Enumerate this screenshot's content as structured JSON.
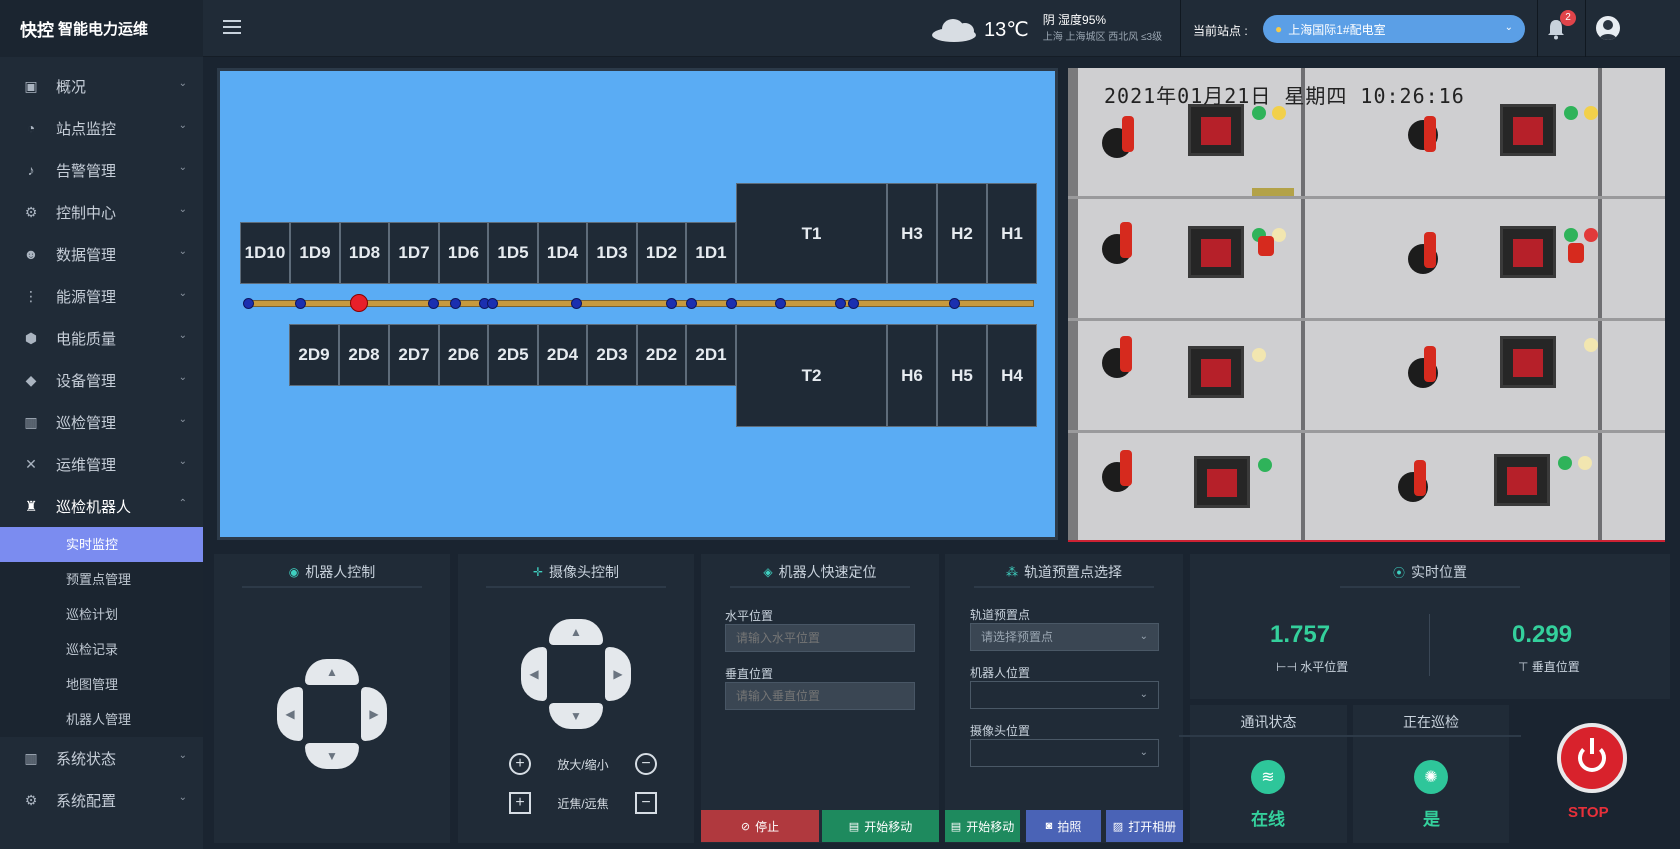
{
  "brand": {
    "title": "快控",
    "subtitle": "智能电力运维"
  },
  "sidebar": {
    "items": [
      {
        "label": "概况",
        "icon": "image-icon"
      },
      {
        "label": "站点监控",
        "icon": "gauge-icon"
      },
      {
        "label": "告警管理",
        "icon": "bell-icon"
      },
      {
        "label": "控制中心",
        "icon": "gear-icon"
      },
      {
        "label": "数据管理",
        "icon": "users-icon"
      },
      {
        "label": "能源管理",
        "icon": "flow-icon"
      },
      {
        "label": "电能质量",
        "icon": "hex-icon"
      },
      {
        "label": "设备管理",
        "icon": "cube-icon"
      },
      {
        "label": "巡检管理",
        "icon": "bar-chart-icon"
      },
      {
        "label": "运维管理",
        "icon": "tools-icon"
      },
      {
        "label": "巡检机器人",
        "icon": "robot-icon"
      },
      {
        "label": "系统状态",
        "icon": "bar-chart-icon"
      },
      {
        "label": "系统配置",
        "icon": "gear-icon"
      }
    ],
    "sub_items": [
      "实时监控",
      "预置点管理",
      "巡检计划",
      "巡检记录",
      "地图管理",
      "机器人管理"
    ]
  },
  "header": {
    "temperature": "13℃",
    "weather_line1": "阴 湿度95%",
    "weather_line2": "上海 上海城区 西北风 ≤3级",
    "station_label": "当前站点 :",
    "station_value": "上海国际1#配电室",
    "notification_count": "2"
  },
  "map": {
    "top_cabinets": [
      "1D10",
      "1D9",
      "1D8",
      "1D7",
      "1D6",
      "1D5",
      "1D4",
      "1D3",
      "1D2",
      "1D1"
    ],
    "bottom_cabinets": [
      "2D9",
      "2D8",
      "2D7",
      "2D6",
      "2D5",
      "2D4",
      "2D3",
      "2D2",
      "2D1"
    ],
    "t1": "T1",
    "t2": "T2",
    "h_top": [
      "H3",
      "H2",
      "H1"
    ],
    "h_bottom": [
      "H6",
      "H5",
      "H4"
    ]
  },
  "camera": {
    "timestamp": "2021年01月21日 星期四 10:26:16"
  },
  "robot_control": {
    "title": "机器人控制"
  },
  "camera_control": {
    "title": "摄像头控制",
    "zoom_label": "放大/缩小",
    "focus_label": "近焦/远焦"
  },
  "quick_position": {
    "title": "机器人快速定位",
    "h_label": "水平位置",
    "h_placeholder": "请输入水平位置",
    "v_label": "垂直位置",
    "v_placeholder": "请输入垂直位置",
    "stop_label": "停止",
    "start_label": "开始移动"
  },
  "preset": {
    "title": "轨道预置点选择",
    "preset_label": "轨道预置点",
    "preset_placeholder": "请选择预置点",
    "robot_pos_label": "机器人位置",
    "camera_pos_label": "摄像头位置",
    "start_label": "开始移动",
    "photo_label": "拍照",
    "album_label": "打开相册"
  },
  "realtime": {
    "title": "实时位置",
    "horizontal_value": "1.757",
    "horizontal_label": "水平位置",
    "vertical_value": "0.299",
    "vertical_label": "垂直位置"
  },
  "status": {
    "comm_title": "通讯状态",
    "comm_value": "在线",
    "patrol_title": "正在巡检",
    "patrol_value": "是",
    "stop_label": "STOP"
  },
  "colors": {
    "accent": "#7b8cf0",
    "map_bg": "#5aacf4",
    "green": "#34d09c",
    "stop": "#d8222c"
  }
}
